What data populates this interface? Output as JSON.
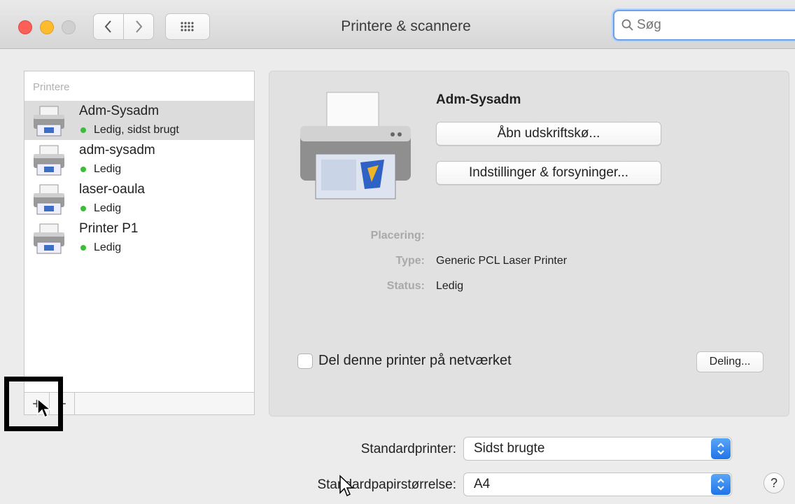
{
  "window": {
    "title": "Printere & scannere",
    "search_placeholder": "Søg"
  },
  "sidebar": {
    "header": "Printere",
    "printers": [
      {
        "name": "Adm-Sysadm",
        "status": "Ledig, sidst brugt",
        "selected": true
      },
      {
        "name": "adm-sysadm",
        "status": "Ledig",
        "selected": false
      },
      {
        "name": "laser-oaula",
        "status": "Ledig",
        "selected": false
      },
      {
        "name": "Printer P1",
        "status": "Ledig",
        "selected": false
      }
    ],
    "add_label": "+",
    "remove_label": "−"
  },
  "detail": {
    "name": "Adm-Sysadm",
    "open_queue_label": "Åbn udskriftskø...",
    "options_label": "Indstillinger & forsyninger...",
    "location_label": "Placering:",
    "location_value": "",
    "type_label": "Type:",
    "type_value": "Generic PCL Laser Printer",
    "status_label": "Status:",
    "status_value": "Ledig",
    "share_label": "Del denne printer på netværket",
    "share_checked": false,
    "sharing_button_label": "Deling..."
  },
  "defaults": {
    "printer_label": "Standardprinter:",
    "printer_value": "Sidst brugte",
    "paper_label": "Standardpapirstørrelse:",
    "paper_value": "A4"
  },
  "help_label": "?",
  "colors": {
    "status_dot": "#3bbd3b",
    "accent": "#1f74e8",
    "highlight_box": "#000000"
  }
}
